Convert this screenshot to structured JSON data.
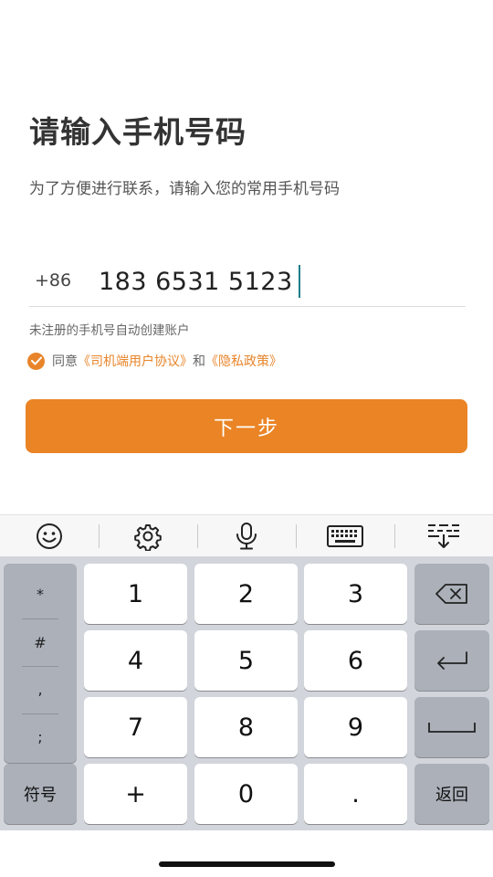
{
  "page": {
    "title": "请输入手机号码",
    "subtitle": "为了方便进行联系，请输入您的常用手机号码"
  },
  "phone": {
    "country_code": "+86",
    "value": "183 6531 5123"
  },
  "hint": "未注册的手机号自动创建账户",
  "agreement": {
    "prefix": "同意",
    "user_agreement": "《司机端用户协议》",
    "conjunction": "和",
    "privacy_policy": "《隐私政策》",
    "checked": true
  },
  "next_button": "下一步",
  "keyboard_toolbar": {
    "icons": [
      "smiley-icon",
      "gear-icon",
      "microphone-icon",
      "keyboard-icon",
      "hide-keyboard-icon"
    ]
  },
  "keyboard": {
    "symbols": [
      "*",
      "#",
      ",",
      ";"
    ],
    "digits": [
      "1",
      "2",
      "3",
      "4",
      "5",
      "6",
      "7",
      "8",
      "9"
    ],
    "symbol_key": "符号",
    "plus_key": "+",
    "zero_key": "0",
    "dot_key": ".",
    "return_key": "返回"
  },
  "colors": {
    "accent": "#ea8425",
    "caret": "#1a7e8a"
  }
}
